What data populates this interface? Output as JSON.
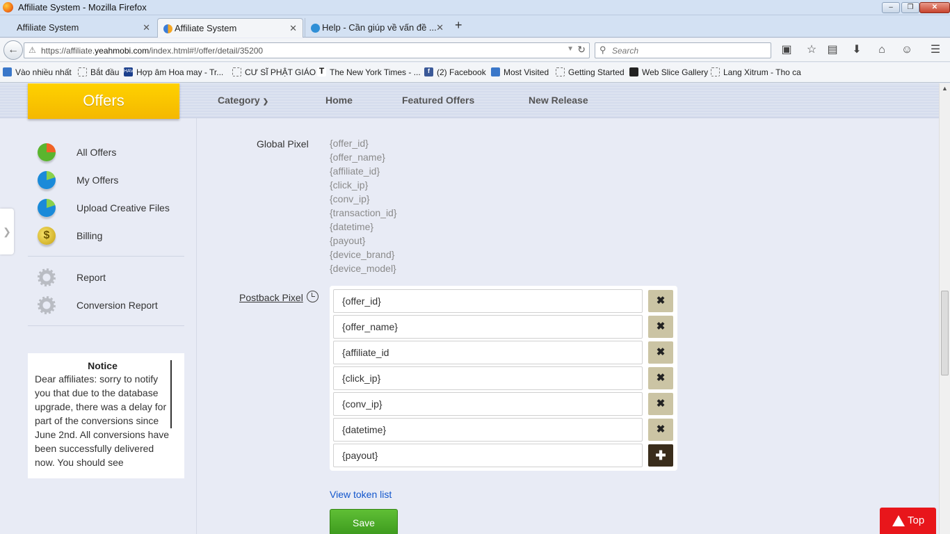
{
  "window": {
    "title": "Affiliate System - Mozilla Firefox"
  },
  "tabs": [
    {
      "label": "Affiliate System"
    },
    {
      "label": "Affiliate System"
    },
    {
      "label": "Help - Cần giúp về vấn đề ..."
    }
  ],
  "address": {
    "prefix": "https://affiliate.",
    "domain": "yeahmobi.com",
    "path": "/index.html#!/offer/detail/35200"
  },
  "search": {
    "placeholder": "Search"
  },
  "bookmarks": [
    "Vào nhiều nhất",
    "Bắt đầu",
    "Hợp âm Hoa may - Tr...",
    "CƯ SĨ PHẬT GIÁO",
    "The New York Times - ...",
    "(2) Facebook",
    "Most Visited",
    "Getting Started",
    "Web Slice Gallery",
    "Lang Xitrum - Tho ca"
  ],
  "header": {
    "brand": "Offers",
    "nav": {
      "category": "Category",
      "home": "Home",
      "featured": "Featured Offers",
      "new_release": "New Release"
    }
  },
  "sidebar": {
    "items": [
      {
        "label": "All Offers",
        "icon": "pie-green-icon"
      },
      {
        "label": "My Offers",
        "icon": "pie-blue-icon"
      },
      {
        "label": "Upload Creative Files",
        "icon": "pie-blue-icon"
      },
      {
        "label": "Billing",
        "icon": "coins-icon"
      },
      {
        "label": "Report",
        "icon": "gear-icon"
      },
      {
        "label": "Conversion Report",
        "icon": "gear-icon"
      }
    ],
    "notice": {
      "title": "Notice",
      "body": "Dear affiliates: sorry to notify you that due to the database upgrade, there was a delay for part of the conversions since June 2nd. All conversions have been successfully delivered now. You should see"
    }
  },
  "main": {
    "global_pixel_label": "Global Pixel",
    "global_tokens": [
      "{offer_id}",
      "{offer_name}",
      "{affiliate_id}",
      "{click_ip}",
      "{conv_ip}",
      "{transaction_id}",
      "{datetime}",
      "{payout}",
      "{device_brand}",
      "{device_model}"
    ],
    "postback_label": "Postback Pixel",
    "postback_values": [
      "{offer_id}",
      "{offer_name}",
      "{affiliate_id",
      "{click_ip}",
      "{conv_ip}",
      "{datetime}",
      "{payout}"
    ],
    "view_token_list": "View token list",
    "save_label": "Save",
    "top_label": "Top"
  },
  "colors": {
    "brand_yellow": "#ffd200",
    "save_green": "#4aad26",
    "top_red": "#e8161b",
    "remove_btn": "#cbc4a4",
    "add_btn": "#3a2d1c"
  }
}
